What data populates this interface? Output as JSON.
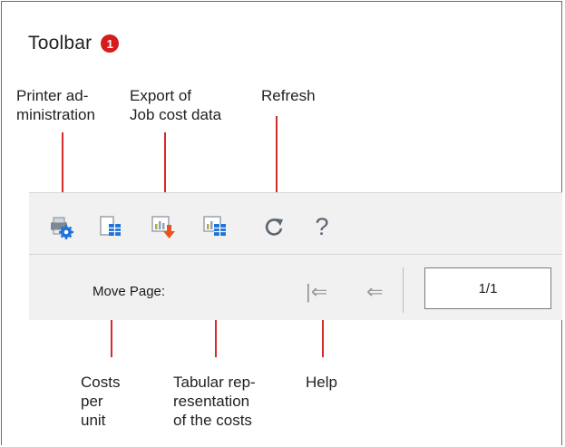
{
  "header": {
    "title": "Toolbar",
    "badge": "1"
  },
  "callouts": {
    "printer_administration": [
      "Printer ad-",
      "ministration"
    ],
    "export_job_cost": [
      "Export of",
      "Job cost data"
    ],
    "refresh": [
      "Refresh"
    ],
    "costs_per_unit": [
      "Costs",
      "per",
      "unit"
    ],
    "tabular_representation": [
      "Tabular rep-",
      "resentation",
      "of the costs"
    ],
    "help": [
      "Help"
    ]
  },
  "toolbar": {
    "icons": [
      "printer-settings-icon",
      "costs-per-unit-icon",
      "export-icon",
      "tabular-costs-icon",
      "refresh-icon",
      "help-icon"
    ],
    "help_glyph": "?"
  },
  "navigation": {
    "move_page_label": "Move Page:",
    "first_page_glyph": "|⇐",
    "prev_page_glyph": "⇐",
    "page_value": "1/1"
  },
  "colors": {
    "accent_red": "#d32a2a",
    "badge_red": "#d51c1c",
    "icon_blue": "#1e73d6",
    "icon_orange": "#e8531f"
  }
}
